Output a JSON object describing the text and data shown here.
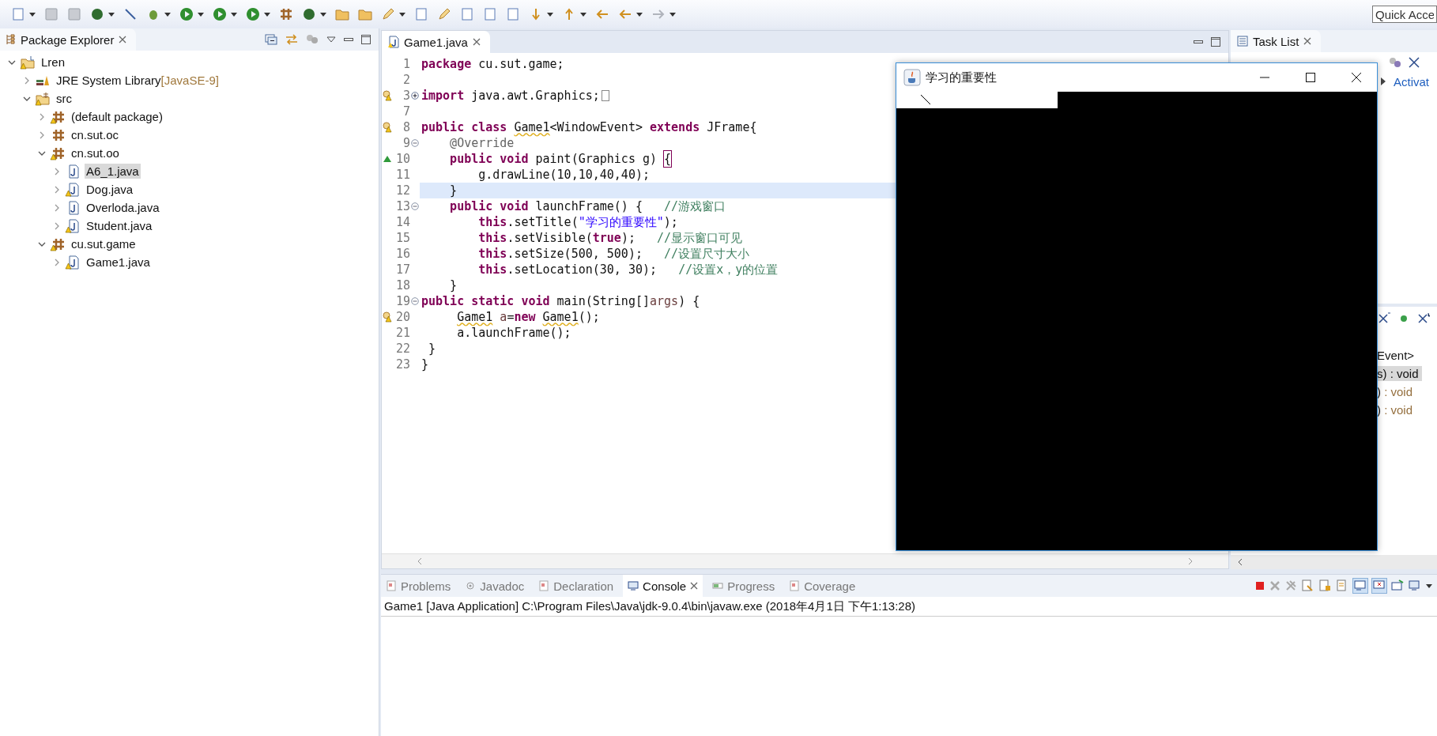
{
  "toolbar": {
    "quick_access": {
      "placeholder": "Quick Acce"
    }
  },
  "package_explorer": {
    "title": "Package Explorer",
    "tree": [
      {
        "label": "Lren",
        "kind": "project",
        "warning": true,
        "expanded": true,
        "selected": false,
        "children": [
          {
            "label": "JRE System Library",
            "decoration": "[JavaSE-9]",
            "kind": "library",
            "warning": false,
            "expanded": false,
            "selected": false
          },
          {
            "label": "src",
            "kind": "source-folder",
            "warning": true,
            "expanded": true,
            "selected": false,
            "children": [
              {
                "label": "(default package)",
                "kind": "package",
                "warning": true,
                "expanded": false,
                "selected": false
              },
              {
                "label": "cn.sut.oc",
                "kind": "package",
                "warning": false,
                "expanded": false,
                "selected": false
              },
              {
                "label": "cn.sut.oo",
                "kind": "package",
                "warning": true,
                "expanded": true,
                "selected": false,
                "children": [
                  {
                    "label": "A6_1.java",
                    "kind": "java-file",
                    "warning": false,
                    "expanded": false,
                    "selected": true
                  },
                  {
                    "label": "Dog.java",
                    "kind": "java-file",
                    "warning": true,
                    "expanded": false,
                    "selected": false
                  },
                  {
                    "label": "Overloda.java",
                    "kind": "java-file",
                    "warning": false,
                    "expanded": false,
                    "selected": false
                  },
                  {
                    "label": "Student.java",
                    "kind": "java-file",
                    "warning": true,
                    "expanded": false,
                    "selected": false
                  }
                ]
              },
              {
                "label": "cu.sut.game",
                "kind": "package",
                "warning": true,
                "expanded": true,
                "selected": false,
                "children": [
                  {
                    "label": "Game1.java",
                    "kind": "java-file",
                    "warning": true,
                    "expanded": false,
                    "selected": false
                  }
                ]
              }
            ]
          }
        ]
      }
    ]
  },
  "editor": {
    "tab": {
      "label": "Game1.java",
      "selected": true
    },
    "lines": [
      {
        "number": "1",
        "current": false,
        "warning": false,
        "override": false,
        "tokens": [
          {
            "kind": "keyword",
            "text": "package"
          },
          {
            "kind": "plain",
            "text": " cu.sut.game;"
          }
        ]
      },
      {
        "number": "2",
        "current": false,
        "warning": false,
        "override": false
      },
      {
        "number": "3",
        "current": false,
        "warning": true,
        "override": false,
        "folded": true,
        "tokens": [
          {
            "kind": "keyword",
            "text": "import"
          },
          {
            "kind": "plain",
            "text": " java.awt.Graphics;"
          }
        ]
      },
      {
        "number": "7",
        "current": false,
        "warning": false,
        "override": false
      },
      {
        "number": "8",
        "current": false,
        "warning": true,
        "override": false,
        "tokens": [
          {
            "kind": "keyword",
            "text": "public class "
          },
          {
            "kind": "squiggle",
            "text": "Game1"
          },
          {
            "kind": "plain",
            "text": "<WindowEvent> "
          },
          {
            "kind": "keyword",
            "text": "extends"
          },
          {
            "kind": "plain",
            "text": " JFrame{"
          }
        ]
      },
      {
        "number": "9",
        "current": false,
        "warning": false,
        "override": false,
        "folded": false,
        "tokens": [
          {
            "kind": "annotation",
            "text": "    @Override"
          }
        ]
      },
      {
        "number": "10",
        "current": false,
        "warning": false,
        "override": true,
        "tokens": [
          {
            "kind": "keyword",
            "text": "    public void"
          },
          {
            "kind": "plain",
            "text": " paint(Graphics g) "
          },
          {
            "kind": "bracket",
            "text": "{"
          }
        ]
      },
      {
        "number": "11",
        "current": false,
        "warning": false,
        "override": false,
        "tokens": [
          {
            "kind": "plain",
            "text": "        g.drawLine(10,10,40,40);"
          }
        ]
      },
      {
        "number": "12",
        "current": true,
        "warning": false,
        "override": false,
        "tokens": [
          {
            "kind": "plain",
            "text": "    }"
          }
        ]
      },
      {
        "number": "13",
        "current": false,
        "warning": false,
        "override": false,
        "folded": false,
        "tokens": [
          {
            "kind": "keyword",
            "text": "    public void"
          },
          {
            "kind": "plain",
            "text": " launchFrame() {   "
          },
          {
            "kind": "comment",
            "text": "//游戏窗口"
          }
        ]
      },
      {
        "number": "14",
        "current": false,
        "warning": false,
        "override": false,
        "tokens": [
          {
            "kind": "keyword",
            "text": "        this"
          },
          {
            "kind": "plain",
            "text": ".setTitle("
          },
          {
            "kind": "string",
            "text": "\"学习的重要性\""
          },
          {
            "kind": "plain",
            "text": ");"
          }
        ]
      },
      {
        "number": "15",
        "current": false,
        "warning": false,
        "override": false,
        "tokens": [
          {
            "kind": "keyword",
            "text": "        this"
          },
          {
            "kind": "plain",
            "text": ".setVisible("
          },
          {
            "kind": "keyword",
            "text": "true"
          },
          {
            "kind": "plain",
            "text": ");   "
          },
          {
            "kind": "comment",
            "text": "//显示窗口可见"
          }
        ]
      },
      {
        "number": "16",
        "current": false,
        "warning": false,
        "override": false,
        "tokens": [
          {
            "kind": "keyword",
            "text": "        this"
          },
          {
            "kind": "plain",
            "text": ".setSize(500, 500);   "
          },
          {
            "kind": "comment",
            "text": "//设置尺寸大小"
          }
        ]
      },
      {
        "number": "17",
        "current": false,
        "warning": false,
        "override": false,
        "tokens": [
          {
            "kind": "keyword",
            "text": "        this"
          },
          {
            "kind": "plain",
            "text": ".setLocation(30, 30);   "
          },
          {
            "kind": "comment",
            "text": "//设置x，y的位置"
          }
        ]
      },
      {
        "number": "18",
        "current": false,
        "warning": false,
        "override": false,
        "tokens": [
          {
            "kind": "plain",
            "text": "    }"
          }
        ]
      },
      {
        "number": "19",
        "current": false,
        "warning": false,
        "override": false,
        "folded": false,
        "tokens": [
          {
            "kind": "keyword",
            "text": "public static void"
          },
          {
            "kind": "plain",
            "text": " main(String[]"
          },
          {
            "kind": "variable",
            "text": "args"
          },
          {
            "kind": "plain",
            "text": ") {"
          }
        ]
      },
      {
        "number": "20",
        "current": false,
        "warning": true,
        "override": false,
        "tokens": [
          {
            "kind": "squiggle",
            "text": "     Game1"
          },
          {
            "kind": "variable",
            "text": " a"
          },
          {
            "kind": "plain",
            "text": "="
          },
          {
            "kind": "keyword",
            "text": "new "
          },
          {
            "kind": "squiggle",
            "text": "Game1"
          },
          {
            "kind": "plain",
            "text": "();"
          }
        ]
      },
      {
        "number": "21",
        "current": false,
        "warning": false,
        "override": false,
        "tokens": [
          {
            "kind": "plain",
            "text": "     a.launchFrame();"
          }
        ]
      },
      {
        "number": "22",
        "current": false,
        "warning": false,
        "override": false,
        "tokens": [
          {
            "kind": "plain",
            "text": " }"
          }
        ]
      },
      {
        "number": "23",
        "current": false,
        "warning": false,
        "override": false,
        "tokens": [
          {
            "kind": "plain",
            "text": "}"
          }
        ]
      }
    ]
  },
  "task_list": {
    "title": "Task List",
    "link": "Activat"
  },
  "outline": {
    "items": [
      {
        "label": "Event>",
        "selected": false
      },
      {
        "label": "s)",
        "type": " : void",
        "selected": true
      },
      {
        "label": ")",
        "type": " : void",
        "selected": false
      },
      {
        "label": ")",
        "type": " : void",
        "selected": false
      }
    ]
  },
  "console": {
    "tabs": [
      {
        "label": "Problems",
        "kind": "problems",
        "selected": false
      },
      {
        "label": "Javadoc",
        "kind": "javadoc",
        "selected": false
      },
      {
        "label": "Declaration",
        "kind": "declaration",
        "selected": false
      },
      {
        "label": "Console",
        "kind": "console",
        "selected": true
      },
      {
        "label": "Progress",
        "kind": "progress",
        "selected": false
      },
      {
        "label": "Coverage",
        "kind": "coverage",
        "selected": false
      }
    ],
    "text": "Game1 [Java Application] C:\\Program Files\\Java\\jdk-9.0.4\\bin\\javaw.exe (2018年4月1日 下午1:13:28)"
  },
  "java_window": {
    "title": "学习的重要性"
  }
}
